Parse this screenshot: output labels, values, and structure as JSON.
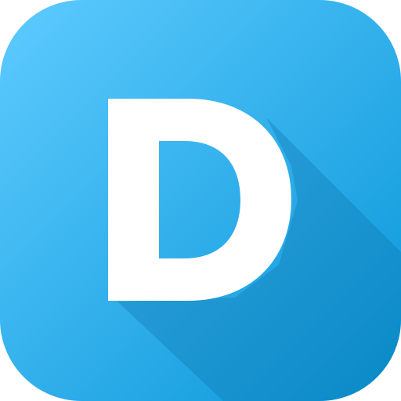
{
  "app_icon": {
    "letter": "D",
    "icon_name": "letter-d-app-icon",
    "colors": {
      "gradient_start": "#5ecbff",
      "gradient_end": "#0896d8",
      "letter": "#ffffff",
      "long_shadow": "#0c6fa8"
    }
  }
}
